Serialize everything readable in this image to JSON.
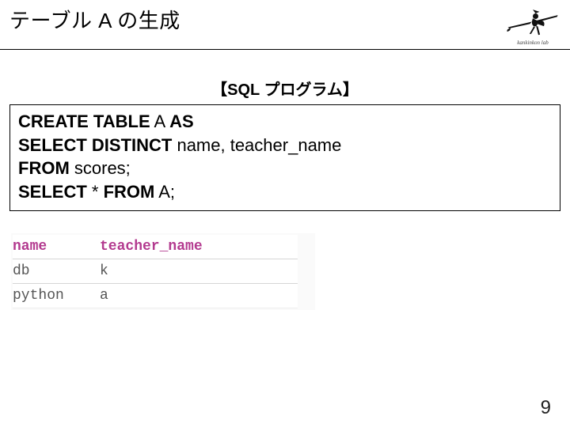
{
  "title": "テーブル A の生成",
  "logo_caption": "kankinkon lab",
  "section_label": "【SQL プログラム】",
  "code": {
    "line1_kw": "CREATE TABLE",
    "line1_rest": " A ",
    "line1_kw2": "AS",
    "line2_kw": "SELECT DISTINCT",
    "line2_rest": " name, teacher_name",
    "line3_kw": "FROM",
    "line3_rest": " scores;",
    "line4_kw1": "SELECT",
    "line4_mid": " * ",
    "line4_kw2": "FROM",
    "line4_rest": " A;"
  },
  "result": {
    "headers": [
      "name",
      "teacher_name"
    ],
    "rows": [
      [
        "db",
        "k"
      ],
      [
        "python",
        "a"
      ]
    ]
  },
  "page_number": "9"
}
